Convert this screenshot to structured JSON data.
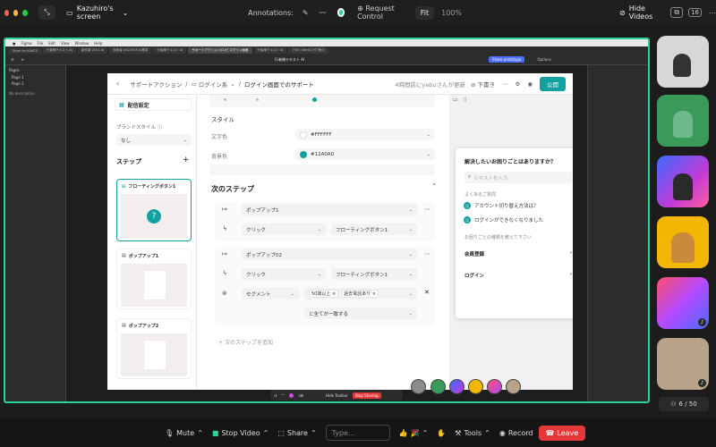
{
  "topbar": {
    "screen_label": "Kazuhiro's screen",
    "annotations_label": "Annotations:",
    "request_control": "Request Control",
    "fit": "Fit",
    "zoom": "100%",
    "hide_videos": "Hide Videos",
    "badge_count": "16"
  },
  "mac_menu": [
    "Figma",
    "File",
    "Edit",
    "View",
    "Window",
    "Help"
  ],
  "chrome_tabs": [
    "Store for KANTS",
    "行者様テキスト AI",
    "製作者 VOL1 AI",
    "技術者 AKZ1905 AI基準",
    "行者様テキスト AI",
    "サポートアクション(ロ)ピ ログイン画面",
    "行者様テキスト AI",
    "7007_Work(ログ)他の"
  ],
  "figma_title": "行者様テキスト AI",
  "figma_share": "Share prototype",
  "figma_options": "Options",
  "layers": {
    "header": "Pages",
    "items": [
      "Page 1",
      "Page 2"
    ],
    "note": "No description"
  },
  "app": {
    "breadcrumb": [
      "サポートアクション",
      "ログイン系",
      "ログイン画面でのサポート"
    ],
    "updated": "4時間前にyabuさんが更新",
    "draft": "下書き",
    "publish": "公開",
    "left": {
      "delivery": "配信設定",
      "brand_style_label": "ブランドスタイル",
      "brand_style_value": "なし",
      "steps_label": "ステップ",
      "add": "+",
      "cards": [
        "フローティングボタン1",
        "ポップアップ1",
        "ポップアップ2"
      ]
    },
    "mid": {
      "style_label": "スタイル",
      "text_color_label": "文字色",
      "text_color_value": "#FFFFFF",
      "bg_color_label": "背景色",
      "bg_color_value": "#12A0A0",
      "next_step_title": "次のステップ",
      "rules": [
        {
          "popup": "ポップアップ1",
          "action": "クリック",
          "target": "フローティングボタン1"
        },
        {
          "popup": "ポップアップ02",
          "action": "クリック",
          "target": "フローティングボタン1",
          "segment": "セグメント",
          "tags": [
            "50歳以上",
            "過去電話あり"
          ],
          "match": "と全てが一致する"
        }
      ],
      "add_next": "次のステップを追加"
    },
    "widget": {
      "title": "解決したいお困りごとはありますか？",
      "search_placeholder": "テキストを入力",
      "faq_label": "よくあるご質問",
      "faq": [
        "アカウント切り替え方法は？",
        "ログインができなくなりました"
      ],
      "types_label": "お困りごとの種類を教えて下さい",
      "types": [
        "会員登録",
        "ログイン"
      ]
    }
  },
  "sharing_toolbar": {
    "hide": "Hide Toolbar",
    "stop": "Stop Sharing"
  },
  "participants": {
    "count": "6 / 50"
  },
  "bottombar": {
    "mute": "Mute",
    "stop_video": "Stop Video",
    "share": "Share",
    "chat_placeholder": "Type...",
    "tools": "Tools",
    "record": "Record",
    "leave": "Leave"
  },
  "colors": {
    "accent": "#12a0a0",
    "sharing_border": "#2bd39a",
    "leave": "#e5383b"
  }
}
